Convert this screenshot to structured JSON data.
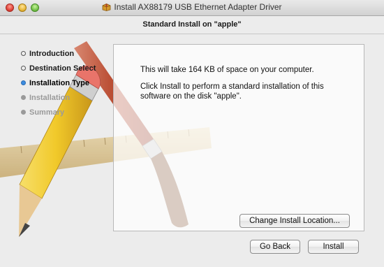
{
  "window": {
    "title": "Install AX88179 USB Ethernet Adapter Driver",
    "icons": {
      "close": "close-icon",
      "minimize": "minimize-icon",
      "zoom": "zoom-icon",
      "title": "package-icon"
    }
  },
  "header": {
    "subtitle": "Standard Install on \"apple\""
  },
  "sidebar": {
    "steps": [
      {
        "label": "Introduction",
        "state": "done"
      },
      {
        "label": "Destination Select",
        "state": "done"
      },
      {
        "label": "Installation Type",
        "state": "current"
      },
      {
        "label": "Installation",
        "state": "future"
      },
      {
        "label": "Summary",
        "state": "future"
      }
    ],
    "current_color": "#3d8de0"
  },
  "content": {
    "space_message": "This will take 164 KB of space on your computer.",
    "install_message": "Click Install to perform a standard installation of this software on the disk \"apple\".",
    "change_location_label": "Change Install Location..."
  },
  "footer": {
    "back_label": "Go Back",
    "install_label": "Install"
  }
}
